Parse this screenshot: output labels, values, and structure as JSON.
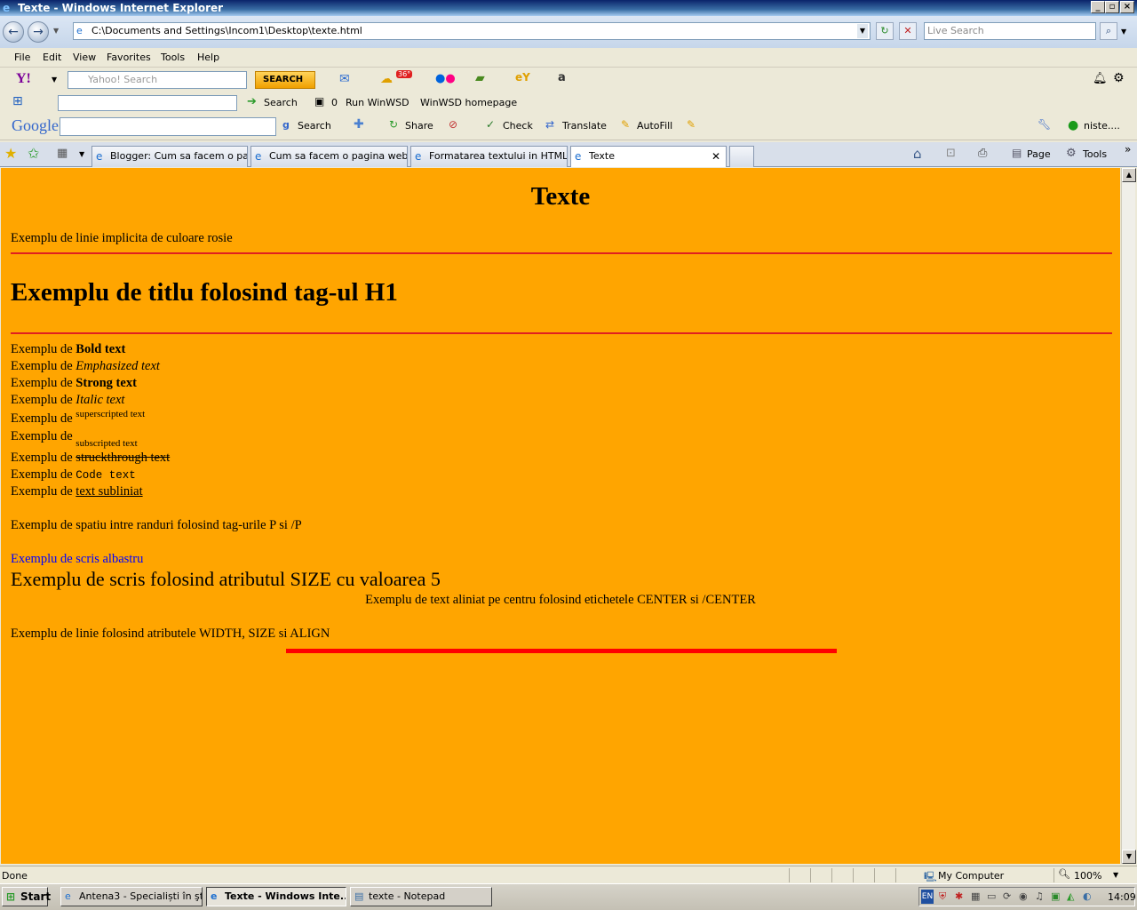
{
  "window": {
    "title": "Texte - Windows Internet Explorer"
  },
  "address_bar": {
    "url": "C:\\Documents and Settings\\Incom1\\Desktop\\texte.html",
    "search_placeholder": "Live Search"
  },
  "menu": [
    "File",
    "Edit",
    "View",
    "Favorites",
    "Tools",
    "Help"
  ],
  "yahoo_toolbar": {
    "search_placeholder": "Yahoo! Search",
    "search_button": "SEARCH",
    "weather_badge": "36°"
  },
  "winwsd_toolbar": {
    "search_label": "Search",
    "count": "0",
    "run_label": "Run WinWSD",
    "homepage_label": "WinWSD homepage"
  },
  "google_toolbar": {
    "logo": "Google",
    "search_label": "Search",
    "share_label": "Share",
    "check_label": "Check",
    "translate_label": "Translate",
    "autofill_label": "AutoFill",
    "account_label": "niste...."
  },
  "tabs": [
    {
      "label": "Blogger: Cum sa facem o pa..."
    },
    {
      "label": "Cum sa facem o pagina web:..."
    },
    {
      "label": "Formatarea textului in HTML"
    },
    {
      "label": "Texte",
      "active": true
    }
  ],
  "command_bar": {
    "page_label": "Page",
    "tools_label": "Tools"
  },
  "page": {
    "title": "Texte",
    "line_default": "Exemplu de linie implicita de culoare rosie",
    "h1": "Exemplu de titlu folosind tag-ul H1",
    "prefix": "Exemplu de",
    "bold": "Bold text",
    "emphasized": "Emphasized text",
    "strong": "Strong text",
    "italic": "Italic text",
    "superscript": "superscripted text",
    "subscript": "subscripted text",
    "strike": "struckthrough text",
    "code": "Code text",
    "underline": "text subliniat",
    "paragraph": "Exemplu de spatiu intre randuri folosind tag-urile P si /P",
    "blue": "Exemplu de scris albastru",
    "size5": "Exemplu de scris folosind atributul SIZE cu valoarea 5",
    "center": "Exemplu de text aliniat pe centru folosind etichetele CENTER si /CENTER",
    "line_attrs": "Exemplu de linie folosind atributele WIDTH, SIZE si ALIGN",
    "colors": {
      "background": "#ffa500",
      "rule": "#ff0000",
      "blue_text": "#0000ff"
    }
  },
  "status_bar": {
    "status": "Done",
    "zone": "My Computer",
    "zoom": "100%"
  },
  "taskbar": {
    "start": "Start",
    "buttons": [
      {
        "label": "Antena3 - Specialiști în şt..."
      },
      {
        "label": "Texte - Windows Inte...",
        "active": true
      },
      {
        "label": "texte - Notepad"
      }
    ],
    "lang": "EN",
    "clock": "14:09"
  }
}
